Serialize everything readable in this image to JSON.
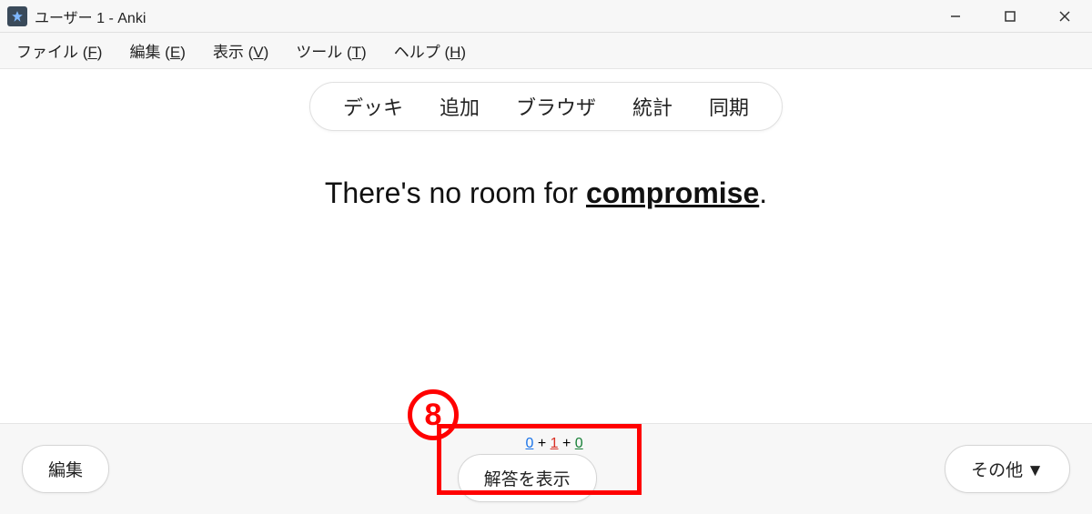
{
  "titlebar": {
    "title": "ユーザー 1 - Anki"
  },
  "menubar": {
    "file": {
      "label": "ファイル",
      "mnemonic": "F"
    },
    "edit": {
      "label": "編集",
      "mnemonic": "E"
    },
    "view": {
      "label": "表示",
      "mnemonic": "V"
    },
    "tools": {
      "label": "ツール",
      "mnemonic": "T"
    },
    "help": {
      "label": "ヘルプ",
      "mnemonic": "H"
    }
  },
  "toolbar": {
    "decks": "デッキ",
    "add": "追加",
    "browse": "ブラウザ",
    "stats": "統計",
    "sync": "同期"
  },
  "card": {
    "prefix": "There's no room for ",
    "underlined": "compromise",
    "suffix": "."
  },
  "counts": {
    "new": "0",
    "sep1": " + ",
    "learn": "1",
    "sep2": " + ",
    "review": "0"
  },
  "buttons": {
    "edit": "編集",
    "show_answer": "解答を表示",
    "more": "その他",
    "more_arrow": "▼"
  },
  "annotation": {
    "number": "8"
  }
}
